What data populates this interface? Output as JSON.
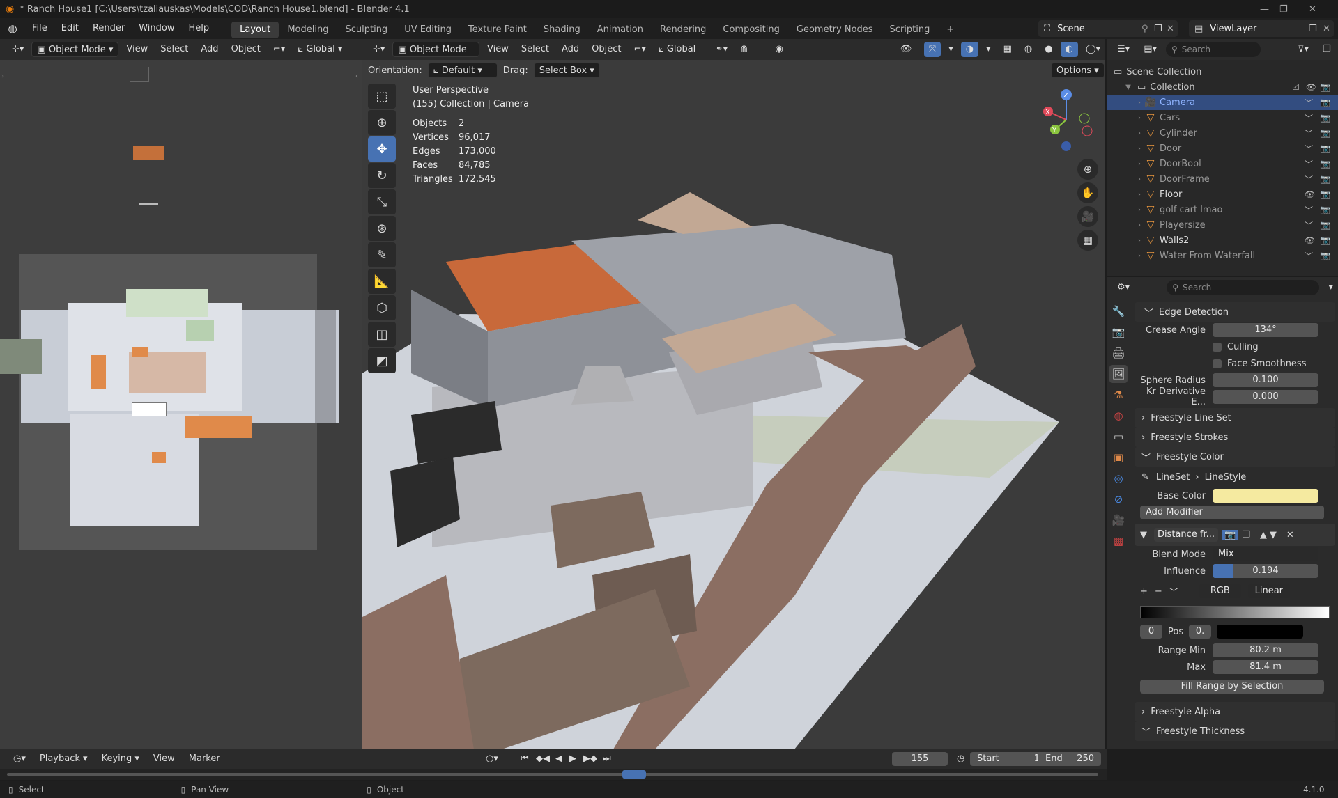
{
  "window": {
    "title": "* Ranch House1 [C:\\Users\\tzaliauskas\\Models\\COD\\Ranch House1.blend] - Blender 4.1"
  },
  "menus": [
    "File",
    "Edit",
    "Render",
    "Window",
    "Help"
  ],
  "workspaces": [
    "Layout",
    "Modeling",
    "Sculpting",
    "UV Editing",
    "Texture Paint",
    "Shading",
    "Animation",
    "Rendering",
    "Compositing",
    "Geometry Nodes",
    "Scripting"
  ],
  "scene": {
    "label": "Scene",
    "viewlayer": "ViewLayer"
  },
  "left_view": {
    "mode": "Object Mode",
    "menus": [
      "View",
      "Select",
      "Add",
      "Object"
    ],
    "transform": "Global"
  },
  "viewport": {
    "mode": "Object Mode",
    "menus": [
      "View",
      "Select",
      "Add",
      "Object"
    ],
    "transform": "Global",
    "orientation_label": "Orientation:",
    "orientation": "Default",
    "drag_label": "Drag:",
    "drag": "Select Box",
    "options": "Options",
    "persp": "User Perspective",
    "context": "(155) Collection | Camera",
    "stats": [
      {
        "k": "Objects",
        "v": "2"
      },
      {
        "k": "Vertices",
        "v": "96,017"
      },
      {
        "k": "Edges",
        "v": "173,000"
      },
      {
        "k": "Faces",
        "v": "84,785"
      },
      {
        "k": "Triangles",
        "v": "172,545"
      }
    ]
  },
  "gizmo": {
    "x": "X",
    "y": "Y",
    "z": "Z"
  },
  "outliner": {
    "search": "Search",
    "scene_collection": "Scene Collection",
    "collection": "Collection",
    "items": [
      "Camera",
      "Cars",
      "Cylinder",
      "Door",
      "DoorBool",
      "DoorFrame",
      "Floor",
      "golf cart lmao",
      "Playersize",
      "Walls2",
      "Water From Waterfall"
    ]
  },
  "props": {
    "search": "Search",
    "edge_detection": "Edge Detection",
    "crease_label": "Crease Angle",
    "crease": "134°",
    "culling": "Culling",
    "face_smooth": "Face Smoothness",
    "sphere_label": "Sphere Radius",
    "sphere": "0.100",
    "kr_label": "Kr Derivative E...",
    "kr": "0.000",
    "s_lineset": "Freestyle Line Set",
    "s_strokes": "Freestyle Strokes",
    "s_color": "Freestyle Color",
    "lineset": "LineSet",
    "linestyle": "LineStyle",
    "base_color_label": "Base Color",
    "base_color": "#f5eaa0",
    "add_modifier": "Add Modifier",
    "modifier_name": "Distance fr...",
    "blend_label": "Blend Mode",
    "blend": "Mix",
    "influence_label": "Influence",
    "influence": "0.194",
    "influence_value": 0.194,
    "rgb": "RGB",
    "linear": "Linear",
    "stop": "0",
    "pos_label": "Pos",
    "pos": "0.",
    "range_min_label": "Range Min",
    "range_min": "80.2 m",
    "max_label": "Max",
    "max": "81.4 m",
    "fill_range": "Fill Range by Selection",
    "s_alpha": "Freestyle Alpha",
    "s_thickness": "Freestyle Thickness"
  },
  "timeline": {
    "menus": [
      "Playback",
      "Keying",
      "View",
      "Marker"
    ],
    "frame": "155",
    "start_label": "Start",
    "start": "1",
    "end_label": "End",
    "end": "250"
  },
  "status": {
    "select": "Select",
    "pan": "Pan View",
    "object": "Object",
    "version": "4.1.0"
  }
}
